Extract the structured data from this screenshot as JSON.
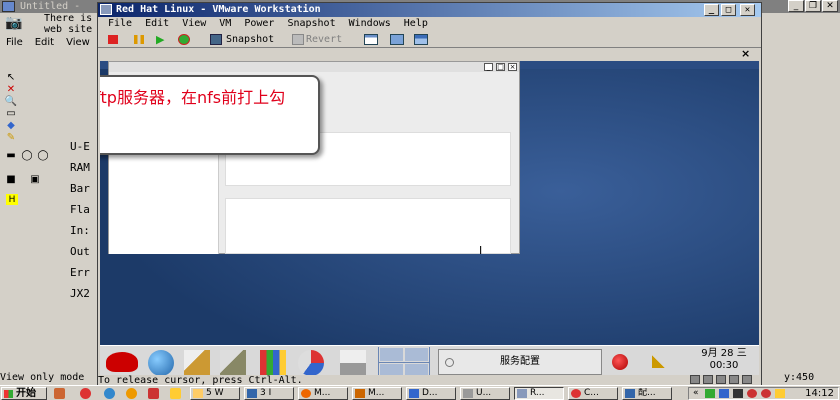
{
  "paint": {
    "title": "Untitled -",
    "tip_text": "There is\nweb site",
    "menu": [
      "File",
      "Edit",
      "View"
    ],
    "side_labels": [
      "U-E",
      "RAM",
      "Bar",
      "Fla",
      "In:",
      "Out",
      "Err",
      "JX2"
    ],
    "status_text": "View only mode",
    "coords": "y:450"
  },
  "vmware": {
    "title": "Red Hat Linux - VMware Workstation",
    "menu": [
      "File",
      "Edit",
      "View",
      "VM",
      "Power",
      "Snapshot",
      "Windows",
      "Help"
    ],
    "toolbar": {
      "snapshot_label": "Snapshot",
      "revert_label": "Revert"
    },
    "status_text": "To release cursor, press Ctrl-Alt."
  },
  "guest": {
    "callout_text": "开启tftp服务器，在nfs前打上勾",
    "service_button_label": "服务配置",
    "clock_date": "9月 28 三",
    "clock_time": "00:30"
  },
  "taskbar": {
    "start_label": "开始",
    "tasks": [
      "5 W",
      "3 I",
      "M...",
      "M...",
      "D...",
      "U...",
      "R...",
      "C...",
      "配..."
    ],
    "time": "14:12"
  },
  "colors": {
    "vmware_title_start": "#0a246a",
    "vmware_title_end": "#a6caf0",
    "guest_desktop": "#24467a",
    "callout_text": "#e0001b"
  }
}
